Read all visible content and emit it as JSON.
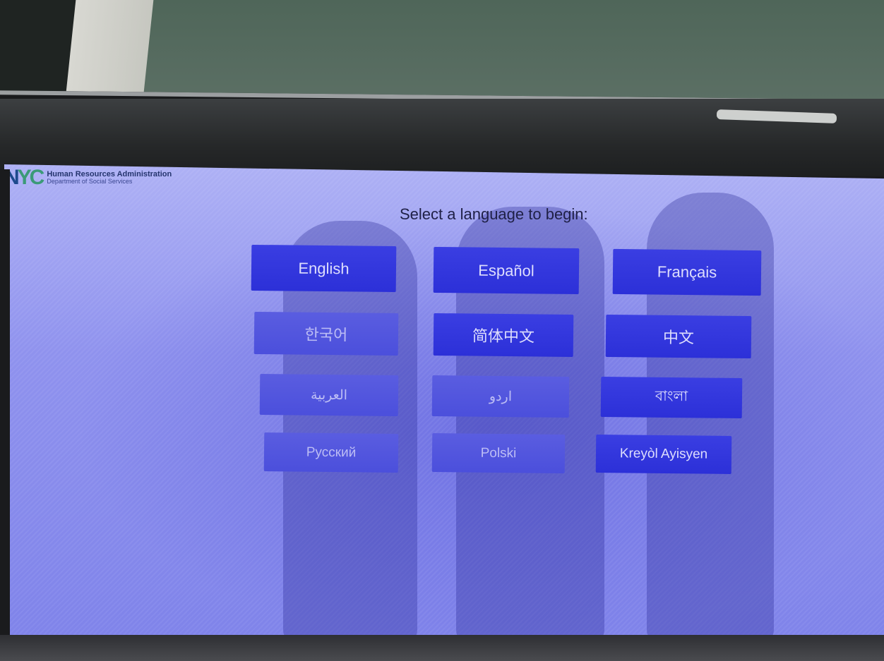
{
  "header": {
    "logo_n": "N",
    "logo_yc": "YC",
    "org_name": "Human Resources Administration",
    "org_dept": "Department of Social Services"
  },
  "prompt": "Select a language to begin:",
  "languages": [
    {
      "label": "English"
    },
    {
      "label": "Español"
    },
    {
      "label": "Français"
    },
    {
      "label": "한국어"
    },
    {
      "label": "简体中文"
    },
    {
      "label": "中文"
    },
    {
      "label": "العربية"
    },
    {
      "label": "اردو"
    },
    {
      "label": "বাংলা"
    },
    {
      "label": "Русский"
    },
    {
      "label": "Polski"
    },
    {
      "label": "Kreyòl Ayisyen"
    }
  ],
  "colors": {
    "button": "#3a3ee2",
    "screen": "#8f92ee",
    "nyc_blue": "#1e4a8c",
    "nyc_green": "#3b9a78"
  }
}
